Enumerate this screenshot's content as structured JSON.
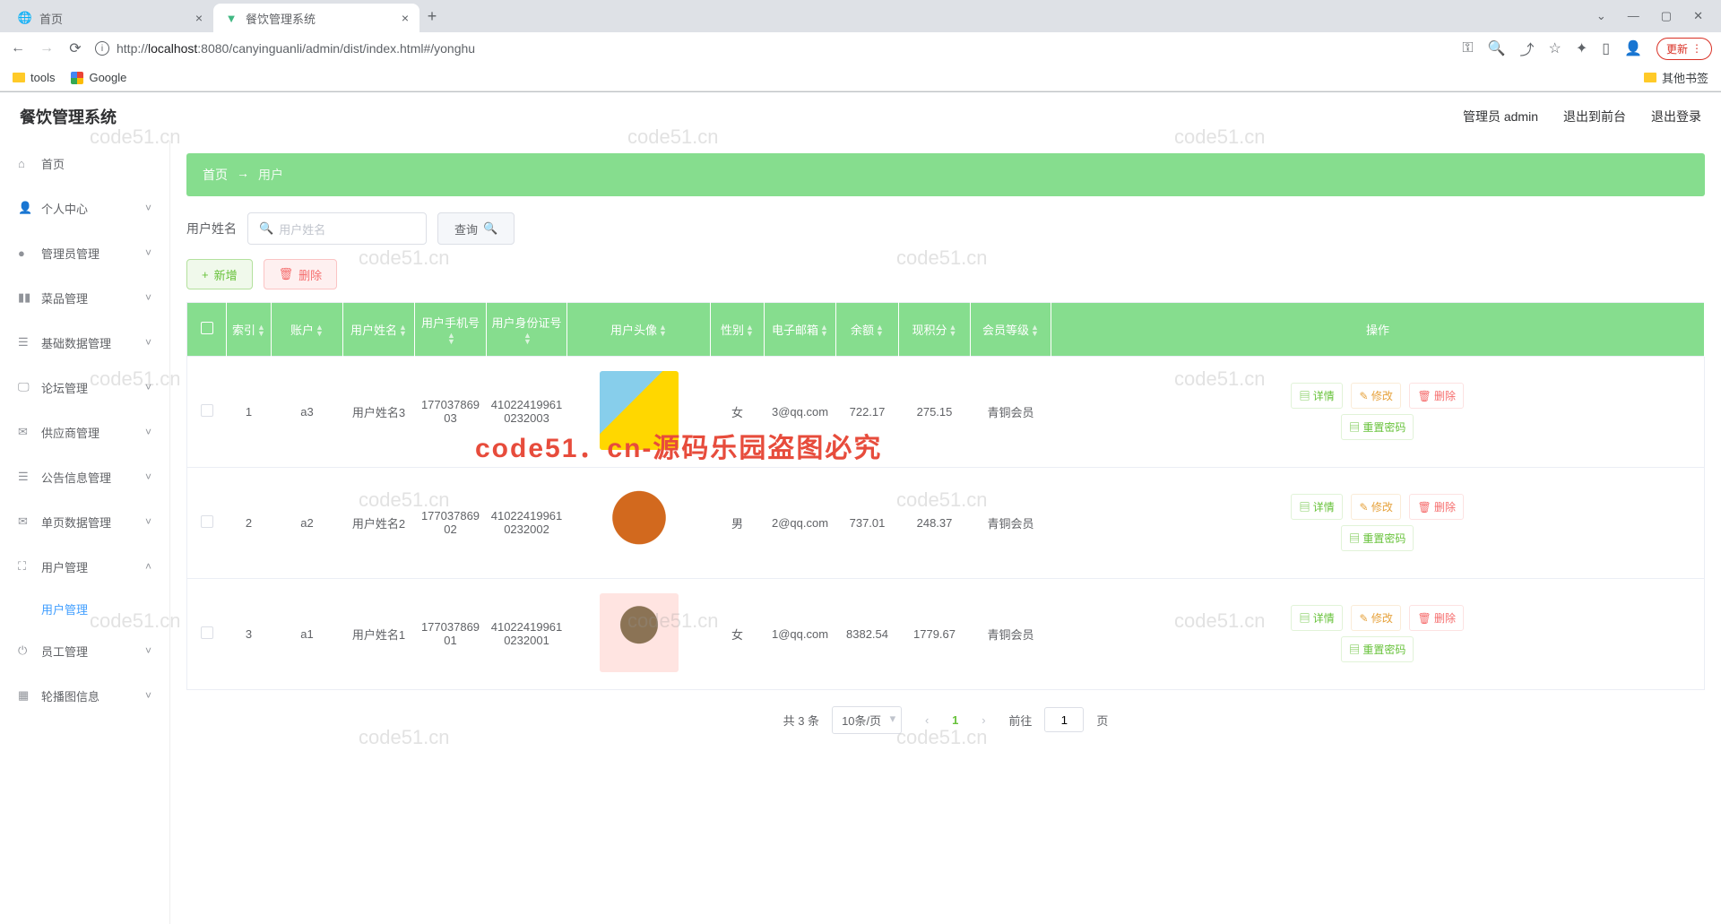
{
  "browser": {
    "tabs": [
      {
        "title": "首页",
        "active": false
      },
      {
        "title": "餐饮管理系统",
        "active": true
      }
    ],
    "url_prefix": "http://",
    "url_host": "localhost",
    "url_port": ":8080",
    "url_path": "/canyinguanli/admin/dist/index.html#/yonghu",
    "update_label": "更新",
    "bookmarks": {
      "tools": "tools",
      "google": "Google",
      "other": "其他书签"
    }
  },
  "header": {
    "title": "餐饮管理系统",
    "admin_label": "管理员 admin",
    "to_front": "退出到前台",
    "logout": "退出登录"
  },
  "sidebar": {
    "items": [
      {
        "label": "首页",
        "icon": "⌂",
        "expandable": false
      },
      {
        "label": "个人中心",
        "icon": "👤",
        "expandable": true
      },
      {
        "label": "管理员管理",
        "icon": "●",
        "expandable": true
      },
      {
        "label": "菜品管理",
        "icon": "▮▮",
        "expandable": true
      },
      {
        "label": "基础数据管理",
        "icon": "☰",
        "expandable": true
      },
      {
        "label": "论坛管理",
        "icon": "🖵",
        "expandable": true
      },
      {
        "label": "供应商管理",
        "icon": "✉",
        "expandable": true
      },
      {
        "label": "公告信息管理",
        "icon": "☰",
        "expandable": true
      },
      {
        "label": "单页数据管理",
        "icon": "✉",
        "expandable": true
      },
      {
        "label": "用户管理",
        "icon": "⛶",
        "expandable": true,
        "expanded": true,
        "sublabel": "用户管理"
      },
      {
        "label": "员工管理",
        "icon": "⏻",
        "expandable": true
      },
      {
        "label": "轮播图信息",
        "icon": "▦",
        "expandable": true
      }
    ]
  },
  "breadcrumb": {
    "home": "首页",
    "arrow": "→",
    "current": "用户"
  },
  "search": {
    "label": "用户姓名",
    "placeholder": "用户姓名",
    "button": "查询"
  },
  "actions": {
    "add": "新增",
    "delete": "删除"
  },
  "table": {
    "headers": [
      "",
      "索引",
      "账户",
      "用户姓名",
      "用户手机号",
      "用户身份证号",
      "用户头像",
      "性别",
      "电子邮箱",
      "余额",
      "现积分",
      "会员等级",
      "操作"
    ],
    "rows": [
      {
        "index": "1",
        "account": "a3",
        "name": "用户姓名3",
        "phone": "17703786903",
        "idcard": "410224199610232003",
        "gender": "女",
        "email": "3@qq.com",
        "balance": "722.17",
        "points": "275.15",
        "level": "青铜会员"
      },
      {
        "index": "2",
        "account": "a2",
        "name": "用户姓名2",
        "phone": "17703786902",
        "idcard": "410224199610232002",
        "gender": "男",
        "email": "2@qq.com",
        "balance": "737.01",
        "points": "248.37",
        "level": "青铜会员"
      },
      {
        "index": "3",
        "account": "a1",
        "name": "用户姓名1",
        "phone": "17703786901",
        "idcard": "410224199610232001",
        "gender": "女",
        "email": "1@qq.com",
        "balance": "8382.54",
        "points": "1779.67",
        "level": "青铜会员"
      }
    ],
    "ops": {
      "detail": "详情",
      "edit": "修改",
      "delete": "删除",
      "reset": "重置密码"
    }
  },
  "pagination": {
    "total": "共 3 条",
    "page_size": "10条/页",
    "current": "1",
    "goto_pre": "前往",
    "goto_value": "1",
    "goto_post": "页"
  },
  "watermark": "code51.cn",
  "watermark_red": "code51．cn-源码乐园盗图必究"
}
